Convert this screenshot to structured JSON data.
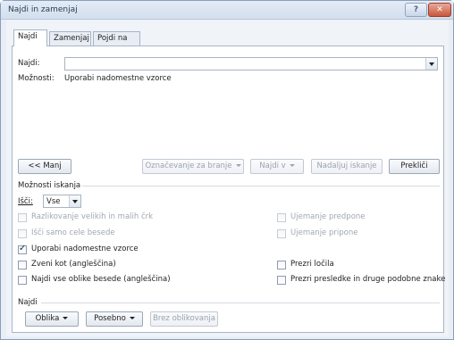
{
  "window": {
    "title": "Najdi in zamenjaj",
    "help_glyph": "?",
    "close_glyph": "✕"
  },
  "tabs": [
    {
      "label": "Najdi",
      "active": true
    },
    {
      "label": "Zamenjaj",
      "active": false
    },
    {
      "label": "Pojdi na",
      "active": false
    }
  ],
  "find": {
    "label": "Najdi:",
    "value": "",
    "options_label": "Možnosti:",
    "options_value": "Uporabi nadomestne vzorce"
  },
  "buttons": {
    "less": "<< Manj",
    "reading_highlight": "Označevanje za branje",
    "find_in": "Najdi v",
    "find_next": "Nadaljuj iskanje",
    "cancel": "Prekliči"
  },
  "search_options": {
    "title": "Možnosti iskanja",
    "search_label": "Išči:",
    "search_value": "Vse",
    "left": [
      {
        "label": "Razlikovanje velikih in malih črk",
        "checked": false,
        "enabled": false
      },
      {
        "label": "Išči samo cele besede",
        "checked": false,
        "enabled": false
      },
      {
        "label": "Uporabi nadomestne vzorce",
        "checked": true,
        "enabled": true
      },
      {
        "label": "Zveni kot (angleščina)",
        "checked": false,
        "enabled": true
      },
      {
        "label": "Najdi vse oblike besede (angleščina)",
        "checked": false,
        "enabled": true
      }
    ],
    "right": [
      {
        "label": "Ujemanje predpone",
        "checked": false,
        "enabled": false
      },
      {
        "label": "Ujemanje pripone",
        "checked": false,
        "enabled": false
      },
      {
        "label": "Prezri ločila",
        "checked": false,
        "enabled": true
      },
      {
        "label": "Prezri presledke in druge podobne znake",
        "checked": false,
        "enabled": true
      }
    ]
  },
  "find_section": {
    "title": "Najdi",
    "format": "Oblika",
    "special": "Posebno",
    "no_formatting": "Brez oblikovanja"
  }
}
